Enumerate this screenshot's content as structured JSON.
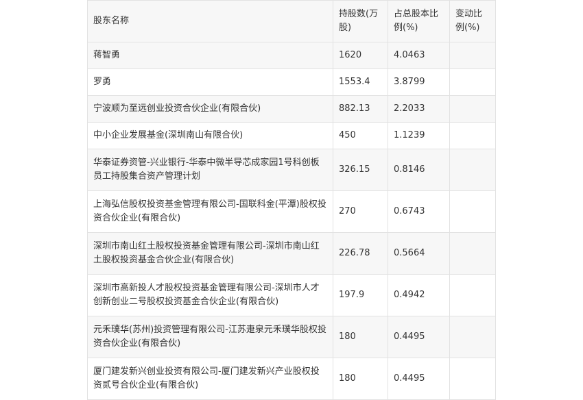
{
  "table": {
    "headers": [
      "股东名称",
      "持股数(万股)",
      "占总股本比例(%)",
      "变动比例(%)"
    ],
    "rows": [
      {
        "name": "蒋智勇",
        "shares": "1620",
        "ratio": "4.0463",
        "change": ""
      },
      {
        "name": "罗勇",
        "shares": "1553.4",
        "ratio": "3.8799",
        "change": ""
      },
      {
        "name": "宁波顺为至远创业投资合伙企业(有限合伙)",
        "shares": "882.13",
        "ratio": "2.2033",
        "change": ""
      },
      {
        "name": "中小企业发展基金(深圳南山有限合伙)",
        "shares": "450",
        "ratio": "1.1239",
        "change": ""
      },
      {
        "name": "华泰证券资管-兴业银行-华泰中微半导芯成家园1号科创板员工持股集合资产管理计划",
        "shares": "326.15",
        "ratio": "0.8146",
        "change": ""
      },
      {
        "name": "上海弘信股权投资基金管理有限公司-国联科金(平潭)股权投资合伙企业(有限合伙)",
        "shares": "270",
        "ratio": "0.6743",
        "change": ""
      },
      {
        "name": "深圳市南山红土股权投资基金管理有限公司-深圳市南山红土股权投资基金合伙企业(有限合伙)",
        "shares": "226.78",
        "ratio": "0.5664",
        "change": ""
      },
      {
        "name": "深圳市高新投人才股权投资基金管理有限公司-深圳市人才创新创业二号股权投资基金合伙企业(有限合伙)",
        "shares": "197.9",
        "ratio": "0.4942",
        "change": ""
      },
      {
        "name": "元禾璞华(苏州)投资管理有限公司-江苏疌泉元禾璞华股权投资合伙企业(有限合伙)",
        "shares": "180",
        "ratio": "0.4495",
        "change": ""
      },
      {
        "name": "厦门建发新兴创业投资有限公司-厦门建发新兴产业股权投资贰号合伙企业(有限合伙)",
        "shares": "180",
        "ratio": "0.4495",
        "change": ""
      }
    ]
  }
}
